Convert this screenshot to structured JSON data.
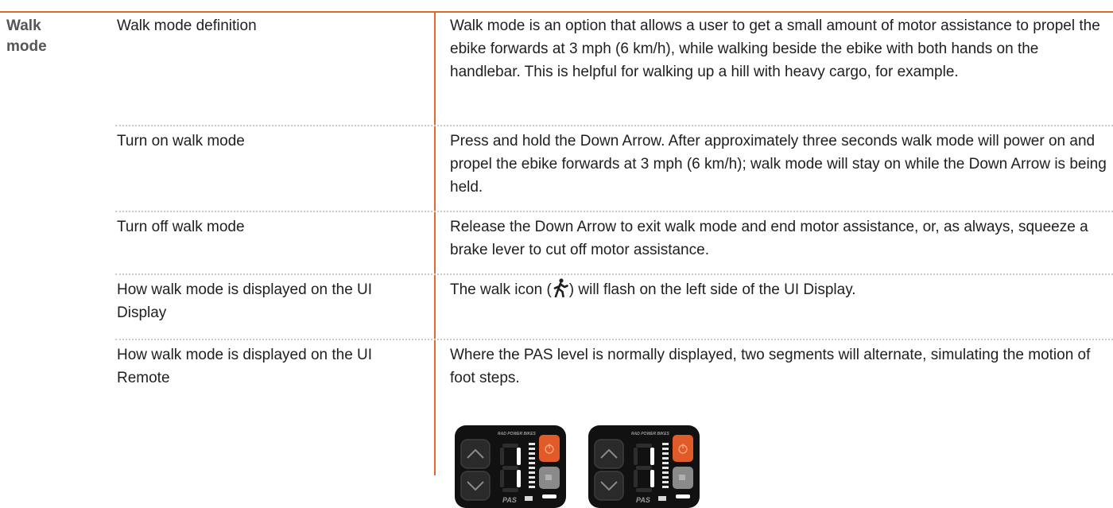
{
  "section": {
    "title": "Walk mode"
  },
  "rows": [
    {
      "term": "Walk mode definition",
      "description": "Walk mode is an option that allows a user to get a small amount of motor assistance to propel the ebike forwards at 3 mph (6 km/h), while walking beside the ebike with both hands on the handlebar. This is helpful for walking up a hill with heavy cargo, for example."
    },
    {
      "term": "Turn on walk mode",
      "description": "Press and hold the Down Arrow. After approximately three seconds walk mode will power on and propel the ebike forwards at 3 mph (6 km/h); walk mode will stay on while the Down Arrow is being held."
    },
    {
      "term": "Turn off walk mode",
      "description": "Release the Down Arrow to exit walk mode and end motor assistance, or, as always, squeeze a brake lever to cut off motor assistance."
    },
    {
      "term": "How walk mode is displayed on the UI Display",
      "description_before": "The walk icon (",
      "description_after": ") will flash on the left side of the UI Display."
    },
    {
      "term": "How walk mode is displayed on the UI Remote",
      "description": "Where the PAS level is normally displayed, two segments will alternate, simulating the motion of foot steps."
    }
  ],
  "remote": {
    "brand": "RAD POWER BIKES",
    "pas_label": "PAS"
  },
  "icons": [
    "walk-icon",
    "power-icon",
    "light-icon",
    "up-arrow-icon",
    "down-arrow-icon",
    "battery-icon"
  ],
  "colors": {
    "accent": "#e06a2e",
    "divider": "#c9c9c9",
    "remote_body": "#111111",
    "power_button": "#e05a2a"
  }
}
